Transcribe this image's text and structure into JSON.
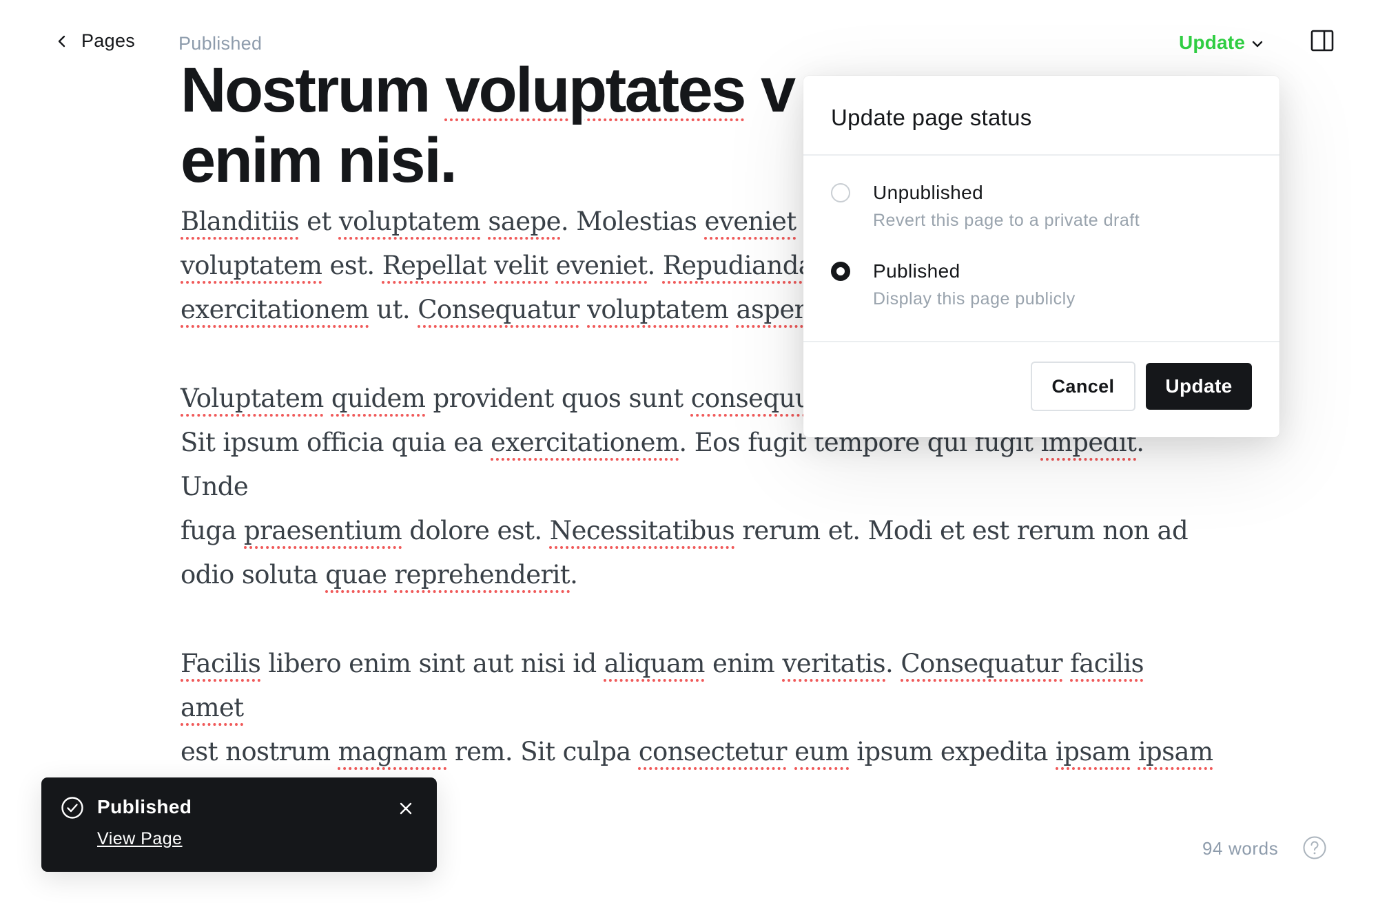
{
  "header": {
    "back_label": "Pages",
    "status": "Published",
    "update_label": "Update"
  },
  "editor": {
    "title_lines": [
      [
        {
          "t": "Nostrum ",
          "s": false
        },
        {
          "t": "voluptates",
          "s": true
        },
        {
          "t": " v",
          "s": false
        }
      ],
      [
        {
          "t": "enim nisi.",
          "s": false
        }
      ]
    ],
    "paragraphs": [
      [
        {
          "t": "Blanditiis",
          "s": true
        },
        {
          "t": " et ",
          "s": false
        },
        {
          "t": "voluptatem",
          "s": true
        },
        {
          "t": " ",
          "s": false
        },
        {
          "t": "saepe",
          "s": true
        },
        {
          "t": ". Molestias ",
          "s": false
        },
        {
          "t": "eveniet",
          "s": true
        },
        {
          "t": " s",
          "s": false
        },
        {
          "t": "\n",
          "s": false
        },
        {
          "t": "voluptatem",
          "s": true
        },
        {
          "t": " est. ",
          "s": false
        },
        {
          "t": "Repellat",
          "s": true
        },
        {
          "t": " ",
          "s": false
        },
        {
          "t": "velit",
          "s": true
        },
        {
          "t": " ",
          "s": false
        },
        {
          "t": "eveniet",
          "s": true
        },
        {
          "t": ". ",
          "s": false
        },
        {
          "t": "Repudianda",
          "s": true
        },
        {
          "t": "\n",
          "s": false
        },
        {
          "t": "exercitationem",
          "s": true
        },
        {
          "t": " ut. ",
          "s": false
        },
        {
          "t": "Consequatur",
          "s": true
        },
        {
          "t": " ",
          "s": false
        },
        {
          "t": "voluptatem",
          "s": true
        },
        {
          "t": " ",
          "s": false
        },
        {
          "t": "asperi",
          "s": true
        }
      ],
      [
        {
          "t": "Voluptatem",
          "s": true
        },
        {
          "t": " ",
          "s": false
        },
        {
          "t": "quidem",
          "s": true
        },
        {
          "t": " provident quos sunt ",
          "s": false
        },
        {
          "t": "consequu",
          "s": true
        },
        {
          "t": "\n",
          "s": false
        },
        {
          "t": "Sit ipsum officia quia ea ",
          "s": false
        },
        {
          "t": "exercitationem",
          "s": true
        },
        {
          "t": ". Eos fugit tempore qui fugit ",
          "s": false
        },
        {
          "t": "impedit",
          "s": true
        },
        {
          "t": ". Unde",
          "s": false
        },
        {
          "t": "\n",
          "s": false
        },
        {
          "t": "fuga ",
          "s": false
        },
        {
          "t": "praesentium",
          "s": true
        },
        {
          "t": " dolore est. ",
          "s": false
        },
        {
          "t": "Necessitatibus",
          "s": true
        },
        {
          "t": " rerum et. Modi et est rerum non ad",
          "s": false
        },
        {
          "t": "\n",
          "s": false
        },
        {
          "t": "odio soluta ",
          "s": false
        },
        {
          "t": "quae",
          "s": true
        },
        {
          "t": " ",
          "s": false
        },
        {
          "t": "reprehenderit",
          "s": true
        },
        {
          "t": ".",
          "s": false
        }
      ],
      [
        {
          "t": "Facilis",
          "s": true
        },
        {
          "t": " libero enim sint aut nisi id ",
          "s": false
        },
        {
          "t": "aliquam",
          "s": true
        },
        {
          "t": " enim ",
          "s": false
        },
        {
          "t": "veritatis",
          "s": true
        },
        {
          "t": ". ",
          "s": false
        },
        {
          "t": "Consequatur",
          "s": true
        },
        {
          "t": " ",
          "s": false
        },
        {
          "t": "facilis",
          "s": true
        },
        {
          "t": " ",
          "s": false
        },
        {
          "t": "amet",
          "s": true
        },
        {
          "t": "\n",
          "s": false
        },
        {
          "t": "est nostrum ",
          "s": false
        },
        {
          "t": "magnam",
          "s": true
        },
        {
          "t": " rem. Sit culpa ",
          "s": false
        },
        {
          "t": "consectetur",
          "s": true
        },
        {
          "t": " ",
          "s": false
        },
        {
          "t": "eum",
          "s": true
        },
        {
          "t": " ipsum expedita ",
          "s": false
        },
        {
          "t": "ipsam",
          "s": true
        },
        {
          "t": " ",
          "s": false
        },
        {
          "t": "ipsam",
          "s": true
        },
        {
          "t": "\n",
          "s": false
        },
        {
          "t": "beatae",
          "s": true
        },
        {
          "t": " ",
          "s": false
        },
        {
          "t": "voluptatem",
          "s": true
        },
        {
          "t": ".",
          "s": false
        }
      ]
    ]
  },
  "popover": {
    "title": "Update page status",
    "options": [
      {
        "label": "Unpublished",
        "description": "Revert this page to a private draft",
        "selected": false
      },
      {
        "label": "Published",
        "description": "Display this page publicly",
        "selected": true
      }
    ],
    "cancel_label": "Cancel",
    "update_label": "Update"
  },
  "toast": {
    "title": "Published",
    "link_label": "View Page"
  },
  "footer": {
    "word_count": "94 words"
  },
  "colors": {
    "accent_green": "#30cf43",
    "spellcheck_red": "#f05a5a",
    "dark": "#15171a"
  },
  "icons": [
    "chevron-left-icon",
    "chevron-down-icon",
    "sidebar-toggle-icon",
    "check-circle-icon",
    "close-icon",
    "help-icon"
  ]
}
